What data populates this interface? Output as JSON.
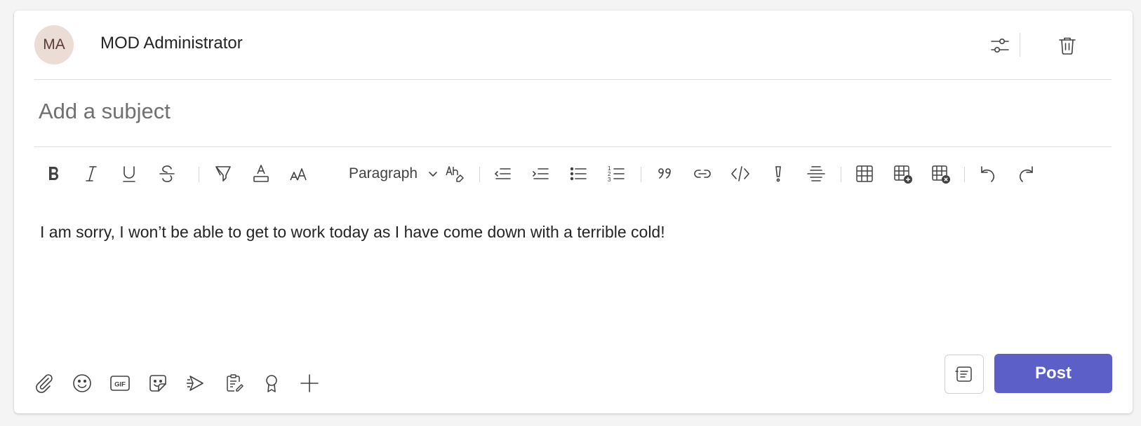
{
  "header": {
    "avatar_initials": "MA",
    "author_name": "MOD Administrator",
    "icons": [
      "sliders-icon",
      "trash-icon"
    ]
  },
  "subject": {
    "placeholder": "Add a subject",
    "value": ""
  },
  "toolbar": {
    "buttons": [
      "bold",
      "italic",
      "underline",
      "strikethrough",
      "highlight",
      "font-color",
      "font-size",
      "paragraph-style",
      "clear-formatting",
      "decrease-indent",
      "increase-indent",
      "bulleted-list",
      "numbered-list",
      "quote",
      "link",
      "code-snippet",
      "important",
      "horizontal-rule",
      "insert-table",
      "add-table-row",
      "delete-table",
      "undo",
      "redo"
    ],
    "paragraph_label": "Paragraph"
  },
  "message": {
    "body": "I am sorry, I won’t be able to get to work today as I have come down with a terrible cold!"
  },
  "actions": {
    "left_icons": [
      "attach-icon",
      "emoji-icon",
      "gif-icon",
      "sticker-icon",
      "schedule-meeting-icon",
      "loop-icon",
      "praise-icon",
      "plus-icon"
    ],
    "post_label": "Post"
  },
  "colors": {
    "accent": "#5b5fc7",
    "avatar_bg": "#ecdcd6"
  }
}
